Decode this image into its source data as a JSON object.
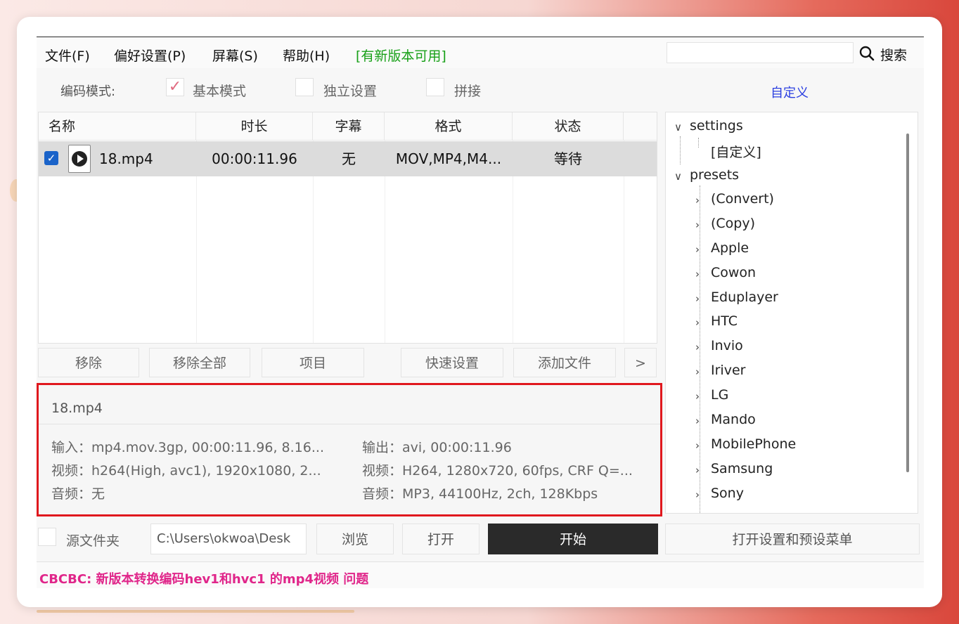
{
  "menu": {
    "file": "文件(F)",
    "preferences": "偏好设置(P)",
    "screen": "屏幕(S)",
    "help": "帮助(H)",
    "new_version": "[有新版本可用]"
  },
  "search": {
    "value": "",
    "label": "搜索"
  },
  "encoding": {
    "label": "编码模式:",
    "basic_mode": "基本模式",
    "basic_checked": true,
    "independent": "独立设置",
    "independent_checked": false,
    "concat": "拼接",
    "concat_checked": false,
    "custom_link": "自定义"
  },
  "table": {
    "headers": [
      "名称",
      "时长",
      "字幕",
      "格式",
      "状态"
    ],
    "rows": [
      {
        "checked": true,
        "name": "18.mp4",
        "duration": "00:00:11.96",
        "subtitle": "无",
        "format": "MOV,MP4,M4...",
        "status": "等待"
      }
    ]
  },
  "actions": {
    "remove": "移除",
    "remove_all": "移除全部",
    "items": "项目",
    "quick_settings": "快速设置",
    "add_file": "添加文件",
    "more": ">"
  },
  "info": {
    "filename": "18.mp4",
    "input": "输入：mp4.mov.3gp, 00:00:11.96, 8.16...",
    "input_video": "视频：h264(High, avc1), 1920x1080, 2...",
    "input_audio": "音频：无",
    "output": "输出：avi, 00:00:11.96",
    "output_video": "视频：H264, 1280x720, 60fps, CRF Q=...",
    "output_audio": "音频：MP3, 44100Hz, 2ch, 128Kbps"
  },
  "tree": {
    "settings": "settings",
    "custom": "[自定义]",
    "presets": "presets",
    "items": [
      "(Convert)",
      "(Copy)",
      "Apple",
      "Cowon",
      "Eduplayer",
      "HTC",
      "Invio",
      "Iriver",
      "LG",
      "Mando",
      "MobilePhone",
      "Samsung",
      "Sony"
    ]
  },
  "bottom": {
    "source_folder": "源文件夹",
    "source_folder_checked": false,
    "path": "C:\\Users\\okwoa\\Desk",
    "browse": "浏览",
    "open": "打开",
    "start": "开始",
    "open_settings_menu": "打开设置和预设菜单"
  },
  "status": "CBCBC: 新版本转换编码hev1和hvc1 的mp4视频 问题"
}
